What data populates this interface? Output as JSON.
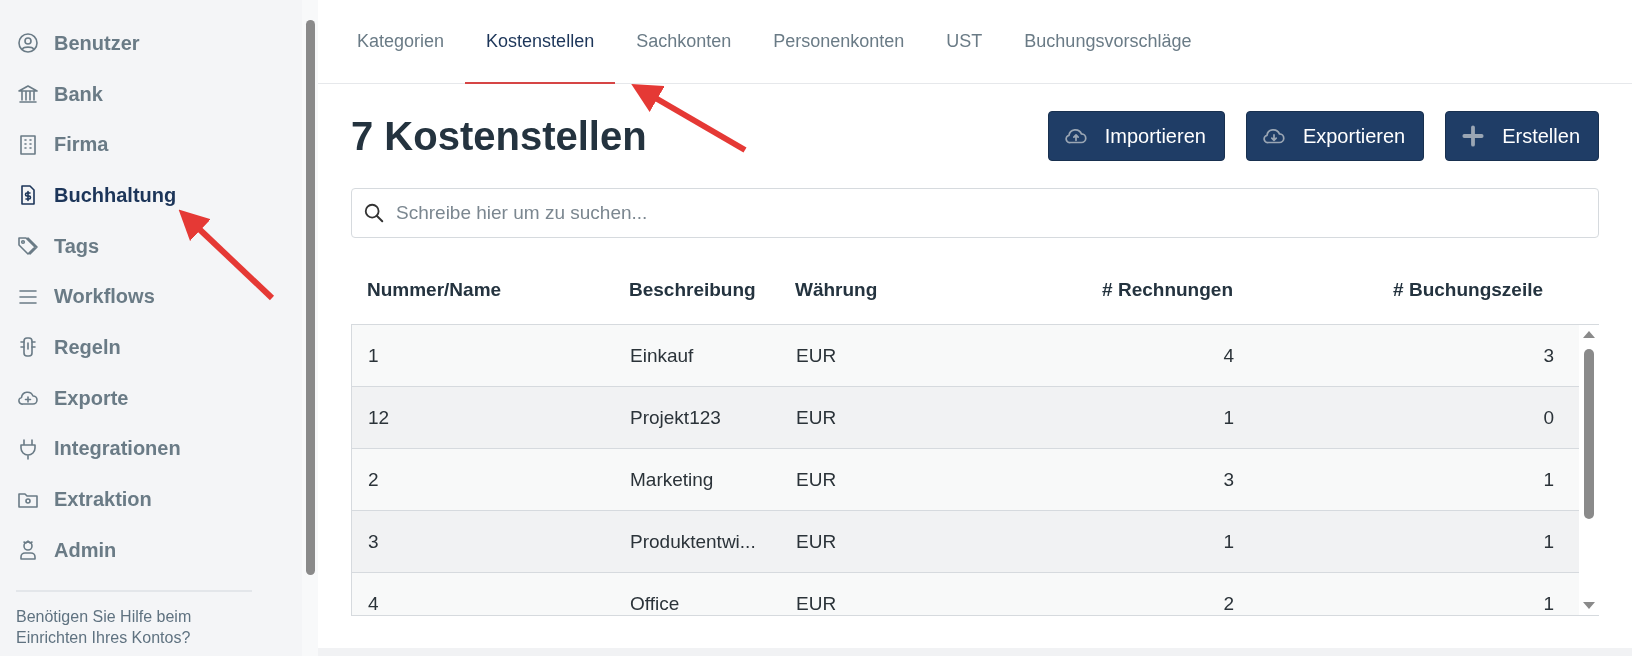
{
  "sidebar": {
    "items": [
      {
        "label": "Benutzer",
        "selected": false
      },
      {
        "label": "Bank",
        "selected": false
      },
      {
        "label": "Firma",
        "selected": false
      },
      {
        "label": "Buchhaltung",
        "selected": true
      },
      {
        "label": "Tags",
        "selected": false
      },
      {
        "label": "Workflows",
        "selected": false
      },
      {
        "label": "Regeln",
        "selected": false
      },
      {
        "label": "Exporte",
        "selected": false
      },
      {
        "label": "Integrationen",
        "selected": false
      },
      {
        "label": "Extraktion",
        "selected": false
      },
      {
        "label": "Admin",
        "selected": false
      }
    ],
    "help_text": "Benötigen Sie Hilfe beim Einrichten Ihres Kontos?"
  },
  "tabs": [
    {
      "label": "Kategorien",
      "selected": false
    },
    {
      "label": "Kostenstellen",
      "selected": true
    },
    {
      "label": "Sachkonten",
      "selected": false
    },
    {
      "label": "Personenkonten",
      "selected": false
    },
    {
      "label": "UST",
      "selected": false
    },
    {
      "label": "Buchungsvorschläge",
      "selected": false
    }
  ],
  "page_title": "7 Kostenstellen",
  "buttons": [
    {
      "label": "Importieren",
      "kind": "upload"
    },
    {
      "label": "Exportieren",
      "kind": "download"
    },
    {
      "label": "Erstellen",
      "kind": "add"
    }
  ],
  "search": {
    "placeholder": "Schreibe hier um zu suchen..."
  },
  "table": {
    "columns": [
      "Nummer/Name",
      "Beschreibung",
      "Währung",
      "# Rechnungen",
      "# Buchungszeile"
    ],
    "rows": [
      [
        "1",
        "Einkauf",
        "EUR",
        "4",
        "3"
      ],
      [
        "12",
        "Projekt123",
        "EUR",
        "1",
        "0"
      ],
      [
        "2",
        "Marketing",
        "EUR",
        "3",
        "1"
      ],
      [
        "3",
        "Produktentwi...",
        "EUR",
        "1",
        "1"
      ],
      [
        "4",
        "Office",
        "EUR",
        "2",
        "1"
      ]
    ]
  }
}
